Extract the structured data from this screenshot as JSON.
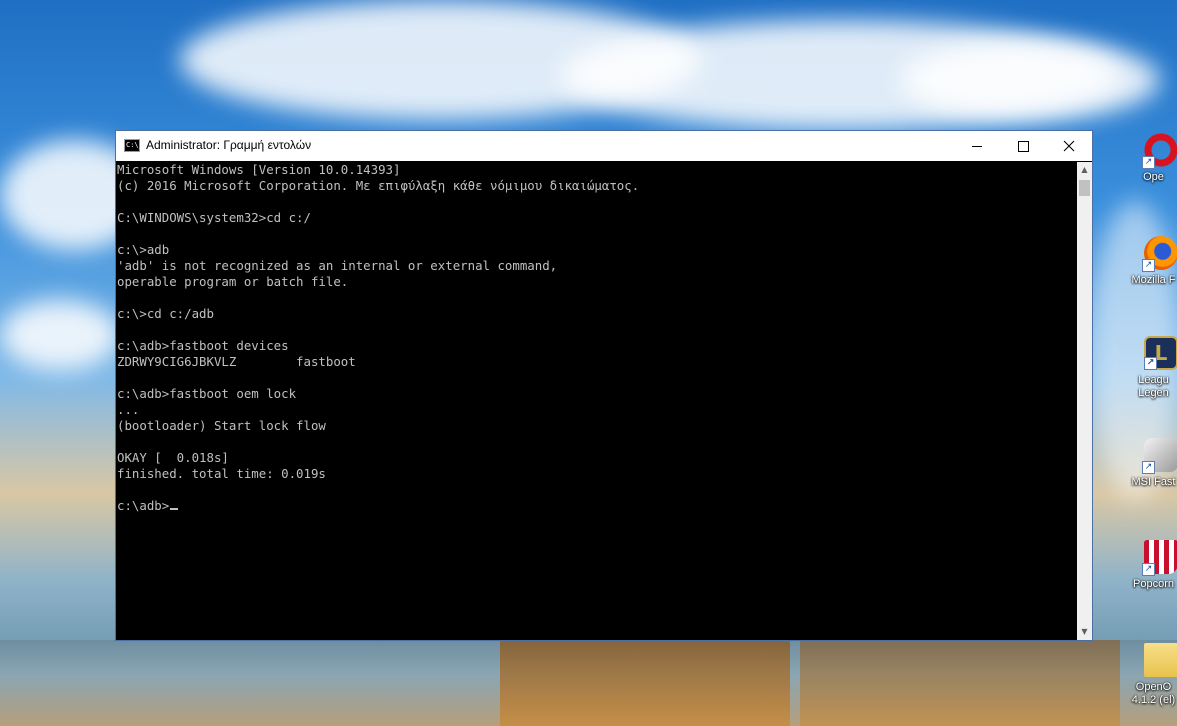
{
  "window": {
    "title": "Administrator: Γραμμή εντολών",
    "icon_label": "C:\\_"
  },
  "console": {
    "lines": [
      "Microsoft Windows [Version 10.0.14393]",
      "(c) 2016 Microsoft Corporation. Με επιφύλαξη κάθε νόμιμου δικαιώματος.",
      "",
      "C:\\WINDOWS\\system32>cd c:/",
      "",
      "c:\\>adb",
      "'adb' is not recognized as an internal or external command,",
      "operable program or batch file.",
      "",
      "c:\\>cd c:/adb",
      "",
      "c:\\adb>fastboot devices",
      "ZDRWY9CIG6JBKVLZ        fastboot",
      "",
      "c:\\adb>fastboot oem lock",
      "...",
      "(bootloader) Start lock flow",
      "",
      "OKAY [  0.018s]",
      "finished. total time: 0.019s",
      ""
    ],
    "prompt": "c:\\adb>"
  },
  "desktop_icons": [
    {
      "label": "Ope",
      "icon": "opera-icon",
      "color": "#d8121f"
    },
    {
      "label": "Mozilla F",
      "icon": "firefox-icon",
      "color": "#e66000"
    },
    {
      "label": "Leagu",
      "label2": "Legen",
      "icon": "league-of-legends-icon",
      "color": "#1a2f5a"
    },
    {
      "label": "MSI Fast",
      "icon": "msi-fastboot-icon",
      "color": "#cfcfcf"
    },
    {
      "label": "Popcorn",
      "icon": "popcorn-icon",
      "color": "#c8102e"
    },
    {
      "label": "OpenO",
      "label2": "4.1.2 (el)",
      "icon": "folder-icon",
      "color": "#f2d36b"
    }
  ],
  "colors": {
    "console_bg": "#000000",
    "console_fg": "#c0c0c0",
    "titlebar_bg": "#ffffff"
  }
}
